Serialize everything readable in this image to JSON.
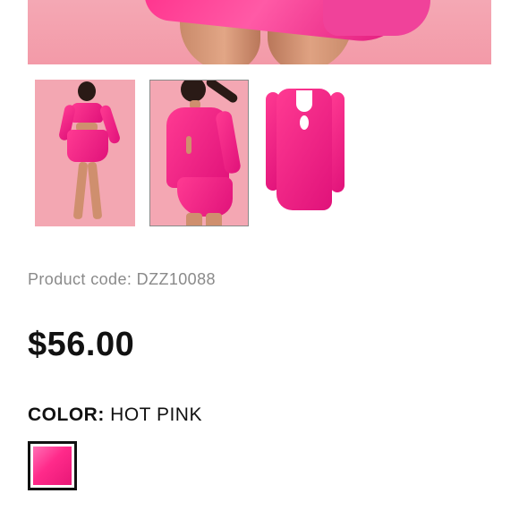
{
  "product": {
    "code_label": "Product code: DZZ10088",
    "price": "$56.00",
    "color_label": "COLOR:",
    "color_value": "HOT PINK",
    "selected_swatch_color": "#ff2a8a"
  },
  "gallery": {
    "thumbnails": [
      {
        "name": "front-view",
        "selected": false
      },
      {
        "name": "back-view",
        "selected": true
      },
      {
        "name": "flat-view",
        "selected": false
      }
    ]
  },
  "colors": {
    "accent": "#ff2a8a",
    "text": "#111111",
    "muted_text": "#8a8a8a"
  }
}
